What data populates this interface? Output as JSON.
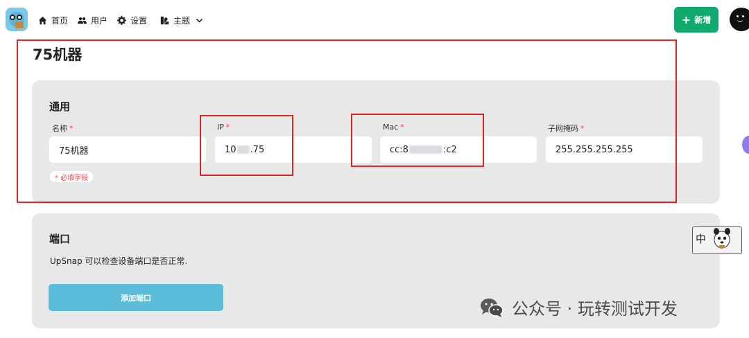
{
  "nav": {
    "home": "首页",
    "users": "用户",
    "settings": "设置",
    "theme": "主题",
    "add_button": "新增"
  },
  "page": {
    "title": "75机器"
  },
  "general": {
    "title": "通用",
    "fields": [
      {
        "label": "名称",
        "required": "*",
        "value": "75机器"
      },
      {
        "label": "IP",
        "required": "*",
        "value_prefix": "10",
        "value_suffix": ".75"
      },
      {
        "label": "Mac",
        "required": "*",
        "value_prefix": "cc:8",
        "value_suffix": ":c2"
      },
      {
        "label": "子网掩码",
        "required": "*",
        "value": "255.255.255.255"
      }
    ],
    "required_note": "* 必填字段"
  },
  "ports": {
    "title": "端口",
    "description": "UpSnap 可以检查设备端口是否正常.",
    "add_port_button": "添加端口"
  },
  "ime": {
    "mode": "中"
  },
  "watermark": {
    "text": "公众号 · 玩转测试开发"
  },
  "colors": {
    "accent_green": "#10a96e",
    "port_button": "#5bbcd9",
    "required_red": "#e5484d",
    "card_bg": "#e8e8e9",
    "annotation_red": "#e02424"
  }
}
